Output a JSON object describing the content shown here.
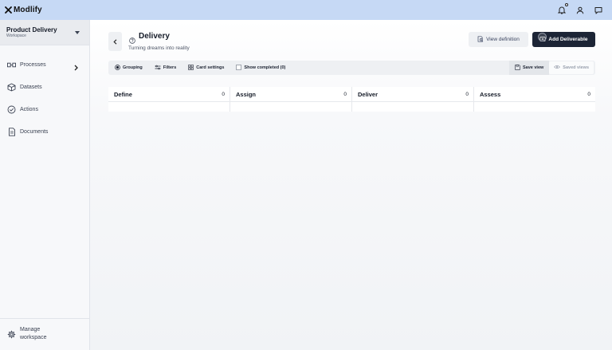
{
  "app": {
    "name": "Modlify"
  },
  "workspace": {
    "name": "Product Delivery",
    "label": "Workspace"
  },
  "sidebar": {
    "items": [
      {
        "label": "Processes",
        "icon": "processes-icon"
      },
      {
        "label": "Datasets",
        "icon": "cube-icon"
      },
      {
        "label": "Actions",
        "icon": "check-circle-icon"
      },
      {
        "label": "Documents",
        "icon": "document-icon"
      }
    ],
    "manage_label": "Manage workspace"
  },
  "page": {
    "title": "Delivery",
    "subtitle": "Turning dreams into reality",
    "view_definition_label": "View definition",
    "add_deliverable_label": "Add Deliverable"
  },
  "toolbar": {
    "grouping_label": "Grouping",
    "filters_label": "Filters",
    "card_settings_label": "Card settings",
    "show_completed_label": "Show completed (0)",
    "save_view_label": "Save view",
    "saved_views_label": "Saved views"
  },
  "board": {
    "columns": [
      {
        "name": "Define",
        "count": "0"
      },
      {
        "name": "Assign",
        "count": "0"
      },
      {
        "name": "Deliver",
        "count": "0"
      },
      {
        "name": "Assess",
        "count": "0"
      }
    ]
  },
  "colors": {
    "topbar": "#c6d9f5",
    "primary_button": "#1d2536",
    "sidebar": "#f7f8fa"
  }
}
